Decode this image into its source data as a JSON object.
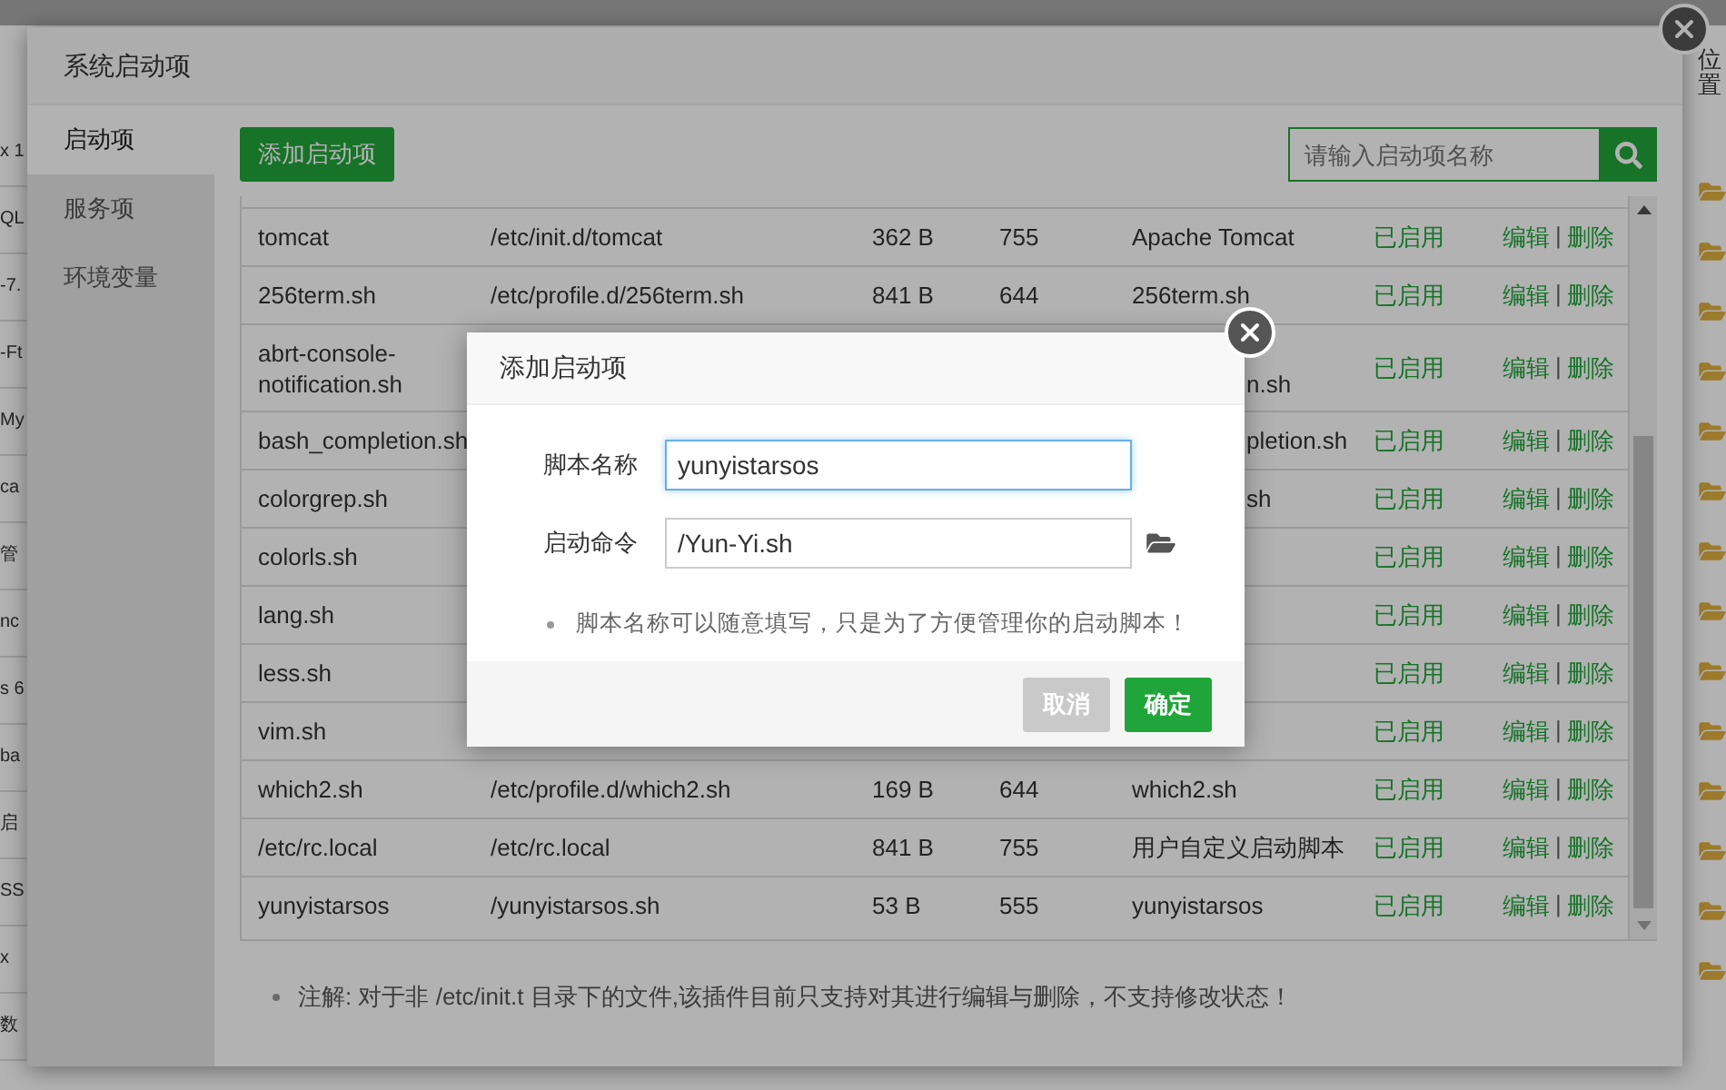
{
  "background_page": {
    "left_fragments": [
      "x 1",
      "QL",
      "-7.",
      "-Ft",
      "My",
      "ca",
      "管",
      "nc",
      "s 6",
      "ba",
      "启",
      "SS",
      "x",
      "数"
    ],
    "right_header": "位置"
  },
  "dialog": {
    "title": "系统启动项",
    "tabs": [
      {
        "label": "启动项",
        "selected": true
      },
      {
        "label": "服务项",
        "selected": false
      },
      {
        "label": "环境变量",
        "selected": false
      }
    ],
    "add_button": "添加启动项",
    "search": {
      "placeholder": "请输入启动项名称"
    },
    "action_separator": "|",
    "rows": [
      {
        "kind": "full",
        "name": "tomcat",
        "path": "/etc/init.d/tomcat",
        "size": "362 B",
        "mode": "755",
        "description": "Apache Tomcat",
        "status": "已启用",
        "actions": [
          "编辑",
          "删除"
        ]
      },
      {
        "kind": "full",
        "name": "256term.sh",
        "path": "/etc/profile.d/256term.sh",
        "size": "841 B",
        "mode": "644",
        "description": "256term.sh",
        "status": "已启用",
        "actions": [
          "编辑",
          "删除"
        ]
      },
      {
        "kind": "covered",
        "name": "abrt-console-notification.sh",
        "description": "\nn.sh",
        "status": "已启用",
        "actions": [
          "编辑",
          "删除"
        ]
      },
      {
        "kind": "covered",
        "name": "bash_completion.sh",
        "description": "pletion.sh",
        "status": "已启用",
        "actions": [
          "编辑",
          "删除"
        ]
      },
      {
        "kind": "covered",
        "name": "colorgrep.sh",
        "description": "sh",
        "status": "已启用",
        "actions": [
          "编辑",
          "删除"
        ]
      },
      {
        "kind": "covered",
        "name": "colorls.sh",
        "status": "已启用",
        "actions": [
          "编辑",
          "删除"
        ]
      },
      {
        "kind": "covered",
        "name": "lang.sh",
        "status": "已启用",
        "actions": [
          "编辑",
          "删除"
        ]
      },
      {
        "kind": "covered",
        "name": "less.sh",
        "status": "已启用",
        "actions": [
          "编辑",
          "删除"
        ]
      },
      {
        "kind": "covered",
        "name": "vim.sh",
        "status": "已启用",
        "actions": [
          "编辑",
          "删除"
        ]
      },
      {
        "kind": "full",
        "name": "which2.sh",
        "path": "/etc/profile.d/which2.sh",
        "size": "169 B",
        "mode": "644",
        "description": "which2.sh",
        "status": "已启用",
        "actions": [
          "编辑",
          "删除"
        ]
      },
      {
        "kind": "full",
        "name": "/etc/rc.local",
        "path": "/etc/rc.local",
        "size": "841 B",
        "mode": "755",
        "description": "用户自定义启动脚本",
        "status": "已启用",
        "actions": [
          "编辑",
          "删除"
        ]
      },
      {
        "kind": "full",
        "name": "yunyistarsos",
        "path": "/yunyistarsos.sh",
        "size": "53 B",
        "mode": "555",
        "description": "yunyistarsos",
        "status": "已启用",
        "actions": [
          "编辑",
          "删除"
        ]
      }
    ],
    "note": "注解: 对于非 /etc/init.t 目录下的文件,该插件目前只支持对其进行编辑与删除，不支持修改状态！"
  },
  "modal": {
    "title": "添加启动项",
    "fields": [
      {
        "kind": "text",
        "label": "脚本名称",
        "value": "yunyistarsos",
        "focused": true
      },
      {
        "kind": "path",
        "label": "启动命令",
        "value": "/Yun-Yi.sh",
        "focused": false
      }
    ],
    "hint": "脚本名称可以随意填写，只是为了方便管理你的启动脚本！",
    "buttons": [
      {
        "label": "取消",
        "kind": "cancel"
      },
      {
        "label": "确定",
        "kind": "confirm"
      }
    ]
  }
}
